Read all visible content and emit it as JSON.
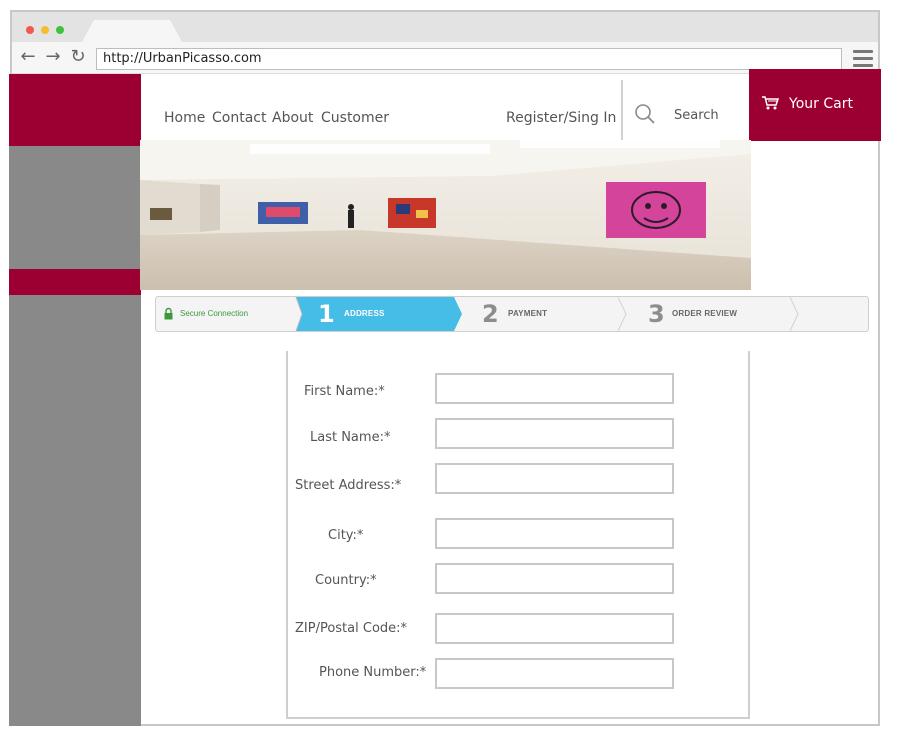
{
  "browser": {
    "url": "http://UrbanPicasso.com",
    "back_icon": "arrow-left-icon",
    "forward_icon": "arrow-right-icon",
    "reload_icon": "reload-icon",
    "menu_icon": "hamburger-menu-icon"
  },
  "nav": {
    "links": [
      "Home",
      "Contact",
      "About",
      "Customer"
    ],
    "register": "Register/Sing In",
    "search_label": "Search",
    "cart_label": "Your Cart"
  },
  "colors": {
    "brand": "#9c0033",
    "sidebar_gray": "#898989",
    "step_active": "#45bde6",
    "secure_green": "#3c9a3c"
  },
  "checkout": {
    "secure_text": "Secure Connection",
    "steps": [
      {
        "number": "1",
        "label": "ADDRESS",
        "active": true
      },
      {
        "number": "2",
        "label": "PAYMENT",
        "active": false
      },
      {
        "number": "3",
        "label": "ORDER REVIEW",
        "active": false
      }
    ]
  },
  "form": {
    "fields": [
      {
        "label": "First Name:*",
        "value": ""
      },
      {
        "label": "Last Name:*",
        "value": ""
      },
      {
        "label": "Street Address:*",
        "value": ""
      },
      {
        "label": "City:*",
        "value": ""
      },
      {
        "label": "Country:*",
        "value": ""
      },
      {
        "label": "ZIP/Postal Code:*",
        "value": ""
      },
      {
        "label": "Phone Number:*",
        "value": ""
      }
    ]
  }
}
